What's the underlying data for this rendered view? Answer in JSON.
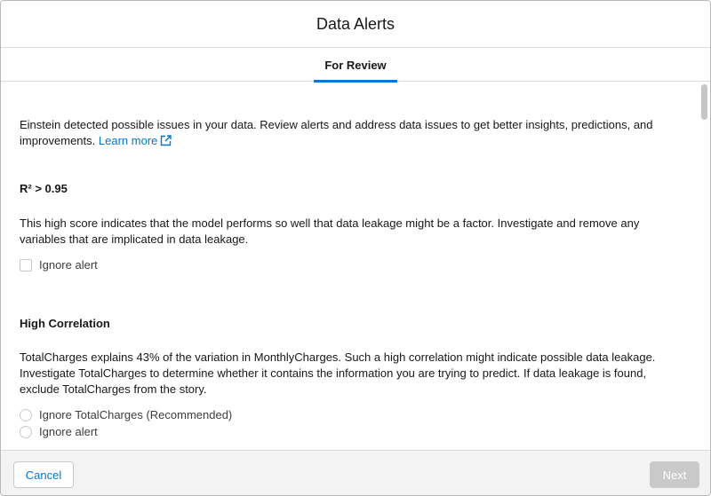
{
  "dialog": {
    "title": "Data Alerts"
  },
  "tabs": [
    {
      "label": "For Review",
      "active": true
    }
  ],
  "intro": {
    "text": "Einstein detected possible issues in your data. Review alerts and address data issues to get better insights, predictions, and improvements.",
    "link_label": "Learn more",
    "link_icon": "external-link-icon"
  },
  "alerts": [
    {
      "title": "R² > 0.95",
      "description": "This high score indicates that the model performs so well that data leakage might be a factor. Investigate and remove any variables that are implicated in data leakage.",
      "checkbox_label": "Ignore alert",
      "checked": false
    },
    {
      "title": "High Correlation",
      "description": "TotalCharges explains 43% of the variation in MonthlyCharges. Such a high correlation might indicate possible data leakage. Investigate TotalCharges to determine whether it contains the information you are trying to predict. If data leakage is found, exclude TotalCharges from the story.",
      "options": [
        {
          "label": "Ignore TotalCharges (Recommended)",
          "selected": false
        },
        {
          "label": "Ignore alert",
          "selected": false
        }
      ]
    }
  ],
  "footer": {
    "cancel_label": "Cancel",
    "next_label": "Next",
    "next_disabled": true
  },
  "colors": {
    "accent": "#0176d3",
    "border": "#dddbda",
    "disabled_button": "#c9c9c9",
    "footer_bg": "#f3f3f3"
  }
}
